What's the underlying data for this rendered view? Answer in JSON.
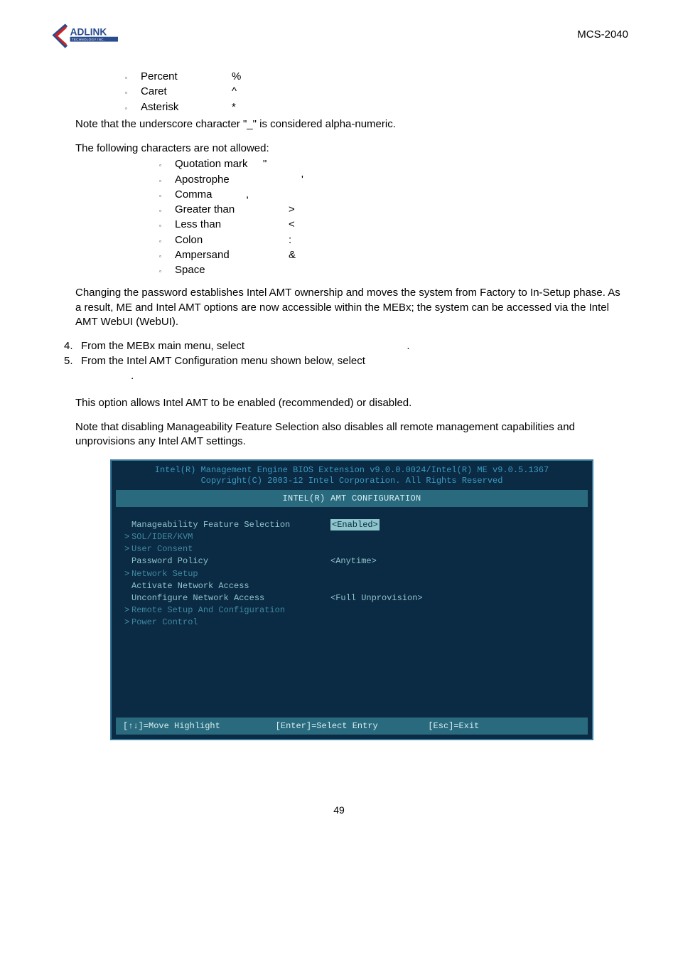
{
  "header": {
    "brand_top": "ADLINK",
    "brand_sub": "TECHNOLOGY INC.",
    "doc_code": "MCS-2040"
  },
  "allowed_chars": {
    "items": [
      {
        "label": "Percent",
        "symbol": "%"
      },
      {
        "label": "Caret",
        "symbol": "^"
      },
      {
        "label": "Asterisk",
        "symbol": "*"
      }
    ]
  },
  "underscore_note": "Note that the underscore character \"_\" is considered alpha-numeric.",
  "not_allowed_heading": "The following characters are not allowed:",
  "not_allowed_chars": {
    "items": [
      {
        "label": "Quotation mark",
        "symbol": "\""
      },
      {
        "label": "Apostrophe",
        "symbol": "'"
      },
      {
        "label": "Comma",
        "symbol": ","
      },
      {
        "label": "Greater than",
        "symbol": ">"
      },
      {
        "label": "Less than",
        "symbol": "<"
      },
      {
        "label": "Colon",
        "symbol": ":"
      },
      {
        "label": "Ampersand",
        "symbol": "&"
      },
      {
        "label": "Space",
        "symbol": ""
      }
    ]
  },
  "para_changing": "Changing the password establishes Intel AMT ownership and moves the system from Factory to In-Setup phase. As a result, ME and Intel AMT options are now accessible within the MEBx; the system can be accessed via the Intel AMT WebUI (WebUI).",
  "steps": {
    "s4": {
      "num": "4.",
      "text_a": "From the MEBx main menu, select ",
      "text_b": "."
    },
    "s5": {
      "num": "5.",
      "text_a": "From the Intel AMT Configuration menu shown below, select ",
      "text_b": "."
    }
  },
  "para_option": "This option allows Intel AMT to be enabled (recommended) or disabled.",
  "para_disable": "Note that disabling Manageability Feature Selection also disables all remote management capabilities and unprovisions any Intel AMT settings.",
  "amt": {
    "top1": "Intel(R) Management Engine BIOS Extension v9.0.0.0024/Intel(R) ME v9.0.5.1367",
    "top2": "Copyright(C) 2003-12 Intel Corporation. All Rights Reserved",
    "title": "INTEL(R) AMT CONFIGURATION",
    "rows": {
      "r0": {
        "arrow": "",
        "left": "Manageability Feature Selection",
        "right": "<Enabled>",
        "enabled": true
      },
      "r1": {
        "arrow": ">",
        "left": "SOL/IDER/KVM",
        "right": ""
      },
      "r2": {
        "arrow": ">",
        "left": "User Consent",
        "right": ""
      },
      "r3": {
        "arrow": "",
        "left": "Password Policy",
        "right": "<Anytime>"
      },
      "r4": {
        "arrow": ">",
        "left": "Network Setup",
        "right": ""
      },
      "r5": {
        "arrow": "",
        "left": "Activate Network Access",
        "right": ""
      },
      "r6": {
        "arrow": "",
        "left": "Unconfigure Network Access",
        "right": "<Full Unprovision>"
      },
      "r7": {
        "arrow": ">",
        "left": "Remote Setup And Configuration",
        "right": ""
      },
      "r8": {
        "arrow": ">",
        "left": "Power Control",
        "right": ""
      }
    },
    "footer": {
      "move": "[↑↓]=Move Highlight",
      "enter": "[Enter]=Select Entry",
      "esc": "[Esc]=Exit"
    }
  },
  "page_number": "49"
}
